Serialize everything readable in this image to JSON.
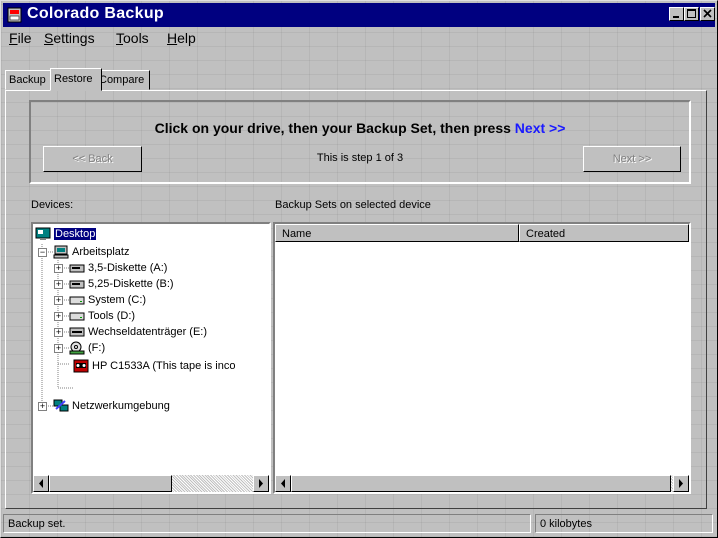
{
  "window": {
    "title": "Colorado Backup",
    "icon": "backup-app-icon",
    "controls": [
      "minimize-icon",
      "maximize-icon",
      "close-icon"
    ]
  },
  "menu": [
    {
      "label": "File",
      "mnemonic": "F",
      "rest": "ile"
    },
    {
      "label": "Settings",
      "mnemonic": "S",
      "rest": "ettings"
    },
    {
      "label": "Tools",
      "mnemonic": "T",
      "rest": "ools"
    },
    {
      "label": "Help",
      "mnemonic": "H",
      "rest": "elp"
    }
  ],
  "tabs": [
    {
      "label": "Backup",
      "active": false
    },
    {
      "label": "Restore",
      "active": true
    },
    {
      "label": "Compare",
      "active": false
    }
  ],
  "wizard": {
    "instruction_prefix": "Click on your drive, then your Backup Set, then press",
    "instruction_link": "Next >>",
    "back_button": "<< Back",
    "next_button": "Next >>",
    "step_text": "This is step 1 of 3",
    "link_color": "#1a1aff"
  },
  "devices": {
    "label": "Devices:",
    "tree": [
      {
        "label": "Desktop",
        "icon": "desktop-icon",
        "selected": true
      },
      {
        "label": "Arbeitsplatz",
        "icon": "computer-icon"
      },
      {
        "label": "3,5-Diskette (A:)",
        "icon": "floppy-drive-icon"
      },
      {
        "label": "5,25-Diskette (B:)",
        "icon": "floppy-drive-icon"
      },
      {
        "label": "System (C:)",
        "icon": "hard-drive-icon"
      },
      {
        "label": "Tools (D:)",
        "icon": "hard-drive-icon"
      },
      {
        "label": "Wechseldatenträger (E:)",
        "icon": "removable-drive-icon"
      },
      {
        "label": "(F:)",
        "icon": "cdrom-drive-icon"
      },
      {
        "label": "HP C1533A (This tape is inco",
        "icon": "tape-drive-icon"
      },
      {
        "label": "Netzwerkumgebung",
        "icon": "network-icon"
      }
    ]
  },
  "backup_sets": {
    "label": "Backup Sets on selected device",
    "columns": [
      "Name",
      "Created"
    ],
    "rows": []
  },
  "status": {
    "message": "Backup set.",
    "size": "0 kilobytes"
  },
  "colors": {
    "titlebar": "#000080",
    "face": "#c0c0c0",
    "selection": "#000080"
  }
}
